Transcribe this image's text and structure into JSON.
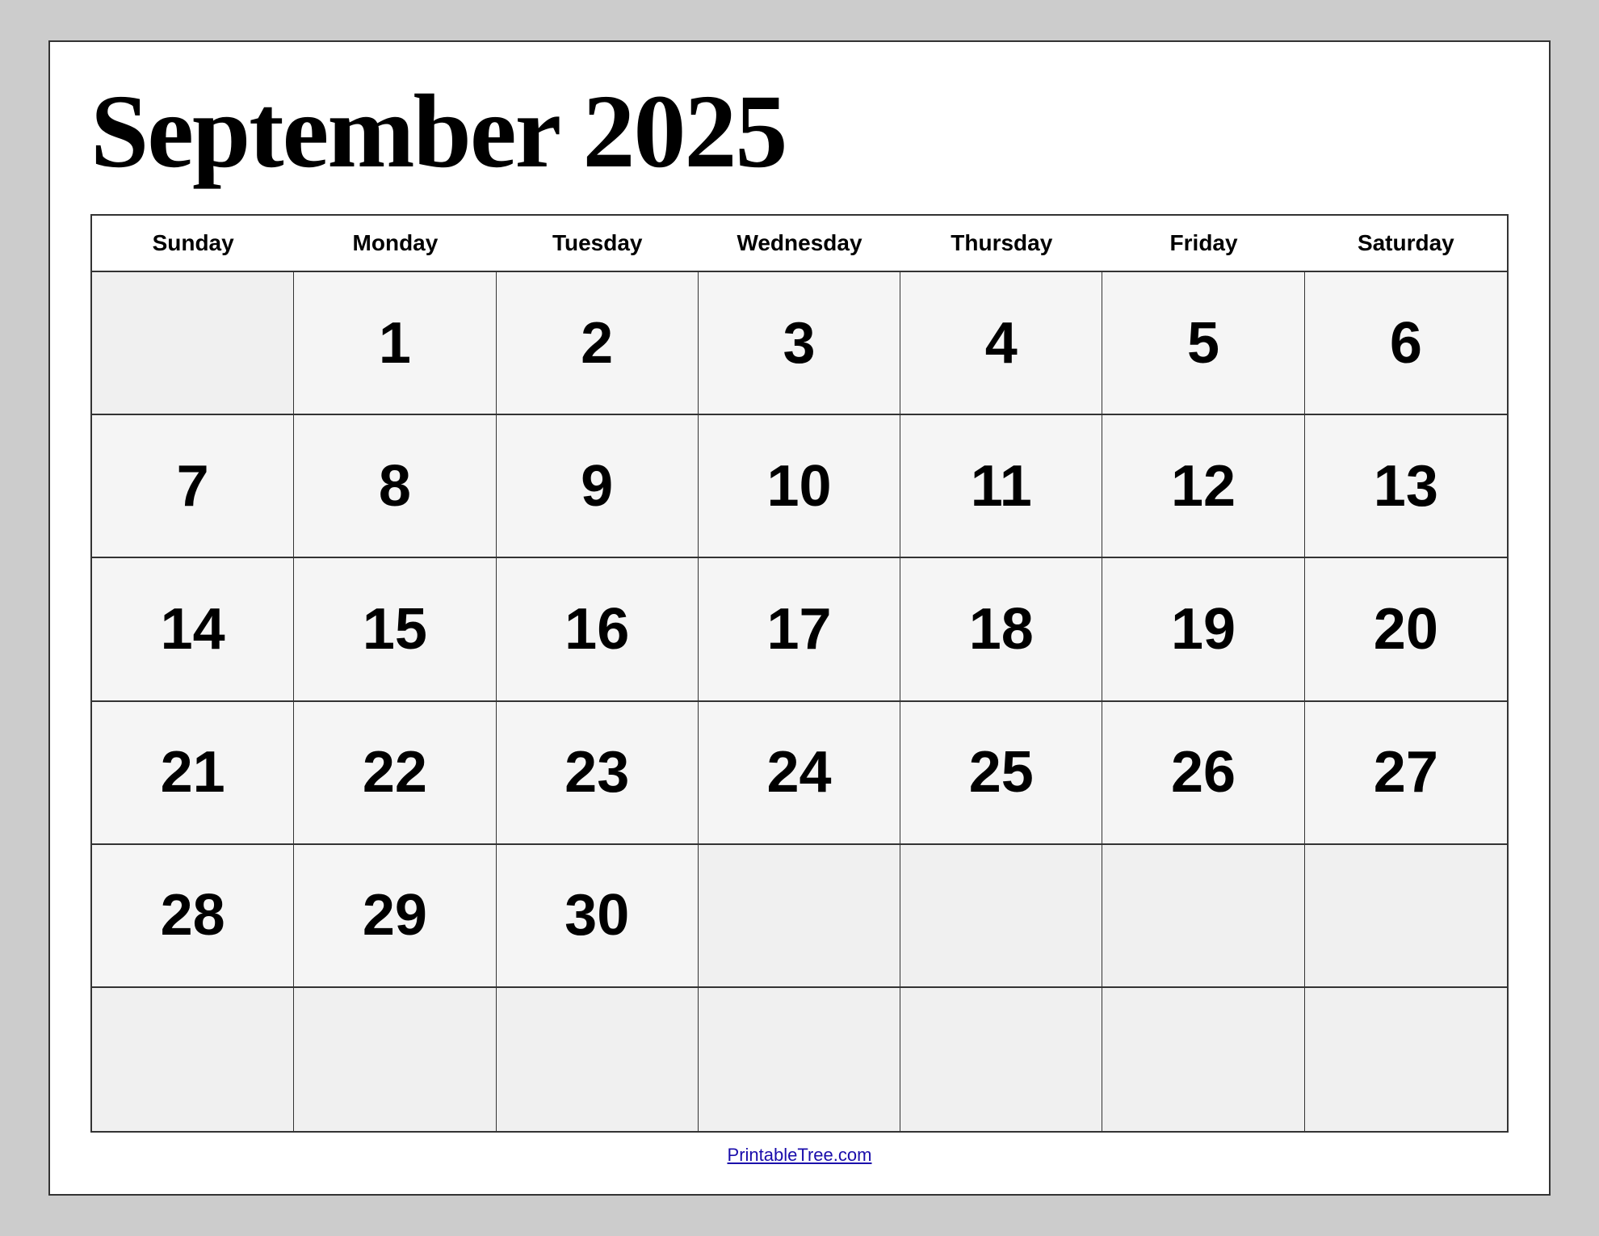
{
  "title": "September 2025",
  "footer_link": "PrintableTree.com",
  "days_of_week": [
    "Sunday",
    "Monday",
    "Tuesday",
    "Wednesday",
    "Thursday",
    "Friday",
    "Saturday"
  ],
  "weeks": [
    [
      null,
      1,
      2,
      3,
      4,
      5,
      6
    ],
    [
      7,
      8,
      9,
      10,
      11,
      12,
      13
    ],
    [
      14,
      15,
      16,
      17,
      18,
      19,
      20
    ],
    [
      21,
      22,
      23,
      24,
      25,
      26,
      27
    ],
    [
      28,
      29,
      30,
      null,
      null,
      null,
      null
    ],
    [
      null,
      null,
      null,
      null,
      null,
      null,
      null
    ]
  ]
}
